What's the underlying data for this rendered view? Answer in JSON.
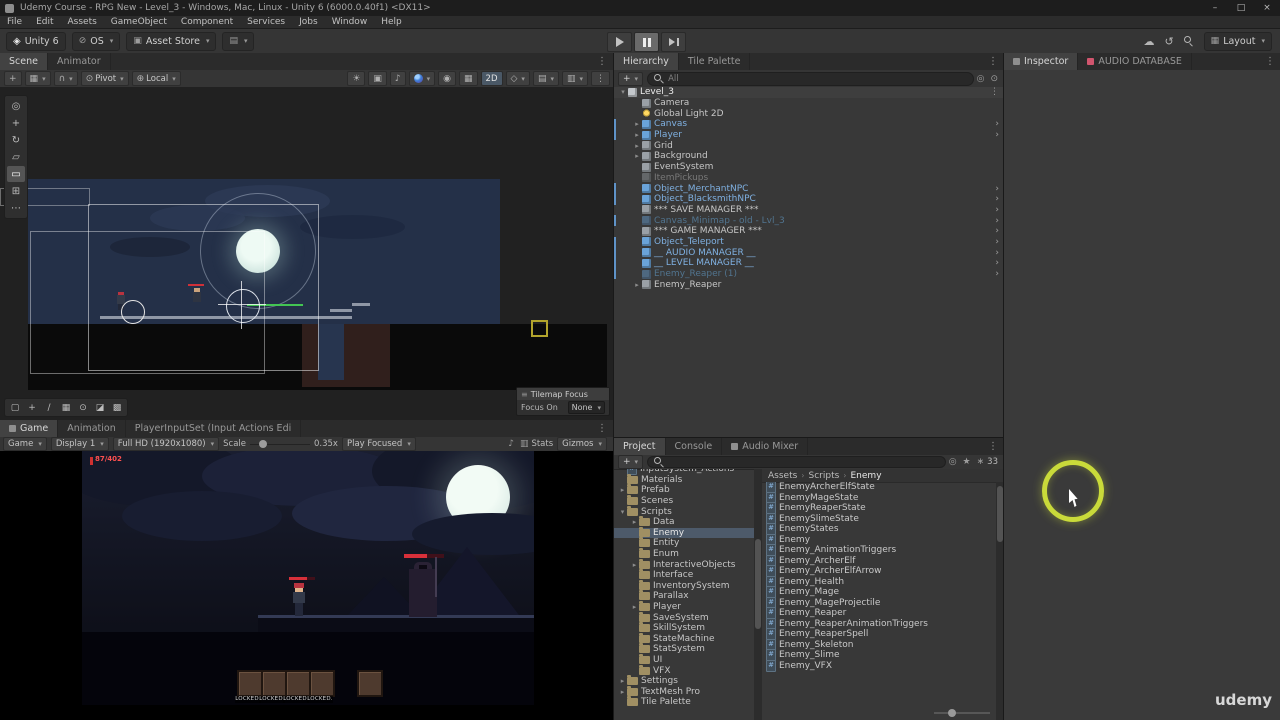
{
  "window": {
    "title": "Udemy Course - RPG New - Level_3 - Windows, Mac, Linux - Unity 6 (6000.0.40f1) <DX11>",
    "controls": {
      "minimize": "–",
      "maximize": "□",
      "close": "×"
    }
  },
  "menu_bar": [
    "File",
    "Edit",
    "Assets",
    "GameObject",
    "Component",
    "Services",
    "Jobs",
    "Window",
    "Help"
  ],
  "top_toolbar": {
    "unity_version": "Unity 6",
    "account_label": "OS",
    "asset_store_label": "Asset Store",
    "layout_label": "Layout",
    "play_controls": [
      "play",
      "pause",
      "step"
    ]
  },
  "scene_panel": {
    "tabs": [
      {
        "label": "Scene"
      },
      {
        "label": "Animator"
      }
    ],
    "toolbar_left": [
      {
        "name": "tool-settings-icon",
        "glyph": "+"
      },
      {
        "name": "grid-snapping-dropdown",
        "glyph": "▦",
        "arrow": true
      },
      {
        "name": "snap-toggle-dropdown",
        "glyph": "∩",
        "arrow": true
      },
      {
        "name": "pivot-mode-dropdown",
        "glyph": "⊙",
        "label": "Pivot",
        "arrow": true
      },
      {
        "name": "orientation-dropdown",
        "glyph": "⊕",
        "label": "Local",
        "arrow": true
      }
    ],
    "toolbar_right": [
      {
        "name": "lighting-toggle-icon",
        "glyph": "☀"
      },
      {
        "name": "camera-view-icon",
        "glyph": "▣"
      },
      {
        "name": "audio-toggle-icon",
        "glyph": "♪"
      },
      {
        "name": "effects-orb-icon",
        "orb": true,
        "arrow": true
      },
      {
        "name": "scene-visibility-icon",
        "glyph": "◉"
      },
      {
        "name": "grid-visibility-icon",
        "glyph": "▦"
      },
      {
        "name": "mode-2d-toggle",
        "label": "2D",
        "active": true
      },
      {
        "name": "gizmo-style-dropdown",
        "glyph": "◇",
        "arrow": true
      },
      {
        "name": "overlays-dropdown",
        "glyph": "▤",
        "arrow": true
      },
      {
        "name": "camera-settings-dropdown",
        "glyph": "▥",
        "arrow": true
      },
      {
        "name": "scene-more-icon",
        "glyph": "⋮"
      }
    ],
    "tools": [
      {
        "name": "view-tool",
        "glyph": "◎"
      },
      {
        "name": "move-tool",
        "glyph": "+"
      },
      {
        "name": "rotate-tool",
        "glyph": "↻"
      },
      {
        "name": "scale-tool",
        "glyph": "▱"
      },
      {
        "name": "rect-tool",
        "glyph": "▭",
        "active": true
      },
      {
        "name": "transform-tool",
        "glyph": "⊞"
      },
      {
        "name": "custom-tool",
        "glyph": "⋯"
      }
    ],
    "tile_tools": [
      {
        "name": "tile-select-tool",
        "glyph": "▢"
      },
      {
        "name": "tile-move-tool",
        "glyph": "+"
      },
      {
        "name": "tile-brush-tool",
        "glyph": "∕"
      },
      {
        "name": "tile-box-tool",
        "glyph": "▦"
      },
      {
        "name": "tile-picker-tool",
        "glyph": "⊙"
      },
      {
        "name": "tile-eraser-tool",
        "glyph": "◪"
      },
      {
        "name": "tile-fill-tool",
        "glyph": "▩"
      }
    ],
    "focus_overlay": {
      "title": "Tilemap Focus",
      "label": "Focus On",
      "value": "None"
    }
  },
  "game_panel": {
    "tabs": [
      {
        "label": "Game",
        "icon": "generic"
      },
      {
        "label": "Animation"
      },
      {
        "label": "PlayerInputSet (Input Actions Edi"
      }
    ],
    "toolbar": {
      "view_selector": "Game",
      "display": "Display 1",
      "resolution": "Full HD (1920x1080)",
      "scale_label": "Scale",
      "scale_value": "0.35x",
      "focus_mode": "Play Focused",
      "stats_label": "Stats",
      "gizmos_label": "Gizmos"
    },
    "hud_health": "87/402",
    "locked_slots": [
      "LOCKED.",
      "LOCKED.",
      "LOCKED.",
      "LOCKED."
    ]
  },
  "hierarchy_panel": {
    "tabs": [
      {
        "label": "Hierarchy"
      },
      {
        "label": "Tile Palette"
      }
    ],
    "search_placeholder": "All",
    "items": [
      {
        "label": "Level_3",
        "icon": "scene",
        "style": "root",
        "expander": "open",
        "menu": true
      },
      {
        "label": "Camera",
        "icon": "camera",
        "style": "normal"
      },
      {
        "label": "Global Light 2D",
        "icon": "light",
        "style": "normal"
      },
      {
        "label": "Canvas",
        "icon": "prefab",
        "style": "prefab",
        "expander": "closed",
        "nav": true,
        "bar": true
      },
      {
        "label": "Player",
        "icon": "prefab",
        "style": "prefab",
        "expander": "closed",
        "nav": true,
        "bar": true
      },
      {
        "label": "Grid",
        "icon": "grid",
        "style": "normal",
        "expander": "closed"
      },
      {
        "label": "Background",
        "icon": "go",
        "style": "normal",
        "expander": "closed"
      },
      {
        "label": "EventSystem",
        "icon": "go",
        "style": "normal"
      },
      {
        "label": "ItemPickups",
        "icon": "go",
        "style": "disabled"
      },
      {
        "label": "Object_MerchantNPC",
        "icon": "prefab",
        "style": "prefab",
        "nav": true,
        "bar": true
      },
      {
        "label": "Object_BlacksmithNPC",
        "icon": "prefab",
        "style": "prefab",
        "nav": true,
        "bar": true
      },
      {
        "label": "*** SAVE MANAGER ***",
        "icon": "go",
        "style": "normal",
        "nav": true
      },
      {
        "label": "Canvas_Minimap - old - Lvl_3",
        "icon": "prefab",
        "style": "disabled-prefab",
        "nav": true,
        "bar": true
      },
      {
        "label": "*** GAME MANAGER ***",
        "icon": "go",
        "style": "normal",
        "nav": true
      },
      {
        "label": "Object_Teleport",
        "icon": "prefab",
        "style": "prefab",
        "nav": true,
        "bar": true
      },
      {
        "label": "__ AUDIO MANAGER __",
        "icon": "prefab",
        "style": "prefab",
        "nav": true,
        "bar": true
      },
      {
        "label": "__ LEVEL MANAGER __",
        "icon": "prefab",
        "style": "prefab",
        "nav": true,
        "bar": true
      },
      {
        "label": "Enemy_Reaper (1)",
        "icon": "prefab",
        "style": "disabled-prefab",
        "nav": true,
        "bar": true
      },
      {
        "label": "Enemy_Reaper",
        "icon": "go",
        "style": "normal",
        "expander": "closed"
      }
    ]
  },
  "project_panel": {
    "tabs": [
      {
        "label": "Project"
      },
      {
        "label": "Console"
      },
      {
        "label": "Audio Mixer",
        "icon": "generic"
      }
    ],
    "search_placeholder": "",
    "hidden_count": "33",
    "breadcrumb": [
      "Assets",
      "Scripts",
      "Enemy"
    ],
    "folders": [
      {
        "label": "InputSystem_Actions",
        "indent": 0,
        "icon": "asset",
        "clipped": true
      },
      {
        "label": "Materials",
        "indent": 0
      },
      {
        "label": "Prefab",
        "indent": 0,
        "expander": "closed"
      },
      {
        "label": "Scenes",
        "indent": 0
      },
      {
        "label": "Scripts",
        "indent": 0,
        "expander": "open"
      },
      {
        "label": "Data",
        "indent": 1,
        "expander": "closed"
      },
      {
        "label": "Enemy",
        "indent": 1,
        "selected": true
      },
      {
        "label": "Entity",
        "indent": 1
      },
      {
        "label": "Enum",
        "indent": 1
      },
      {
        "label": "InteractiveObjects",
        "indent": 1,
        "expander": "closed"
      },
      {
        "label": "Interface",
        "indent": 1
      },
      {
        "label": "InventorySystem",
        "indent": 1
      },
      {
        "label": "Parallax",
        "indent": 1
      },
      {
        "label": "Player",
        "indent": 1,
        "expander": "closed"
      },
      {
        "label": "SaveSystem",
        "indent": 1
      },
      {
        "label": "SkillSystem",
        "indent": 1
      },
      {
        "label": "StateMachine",
        "indent": 1
      },
      {
        "label": "StatSystem",
        "indent": 1
      },
      {
        "label": "UI",
        "indent": 1
      },
      {
        "label": "VFX",
        "indent": 1
      },
      {
        "label": "Settings",
        "indent": 0,
        "expander": "closed"
      },
      {
        "label": "TextMesh Pro",
        "indent": 0,
        "expander": "closed"
      },
      {
        "label": "Tile Palette",
        "indent": 0
      }
    ],
    "files": [
      "EnemyArcherElfState",
      "EnemyMageState",
      "EnemyReaperState",
      "EnemySlimeState",
      "EnemyStates",
      "Enemy",
      "Enemy_AnimationTriggers",
      "Enemy_ArcherElf",
      "Enemy_ArcherElfArrow",
      "Enemy_Health",
      "Enemy_Mage",
      "Enemy_MageProjectile",
      "Enemy_Reaper",
      "Enemy_ReaperAnimationTriggers",
      "Enemy_ReaperSpell",
      "Enemy_Skeleton",
      "Enemy_Slime",
      "Enemy_VFX"
    ]
  },
  "inspector_panel": {
    "tabs": [
      {
        "label": "Inspector",
        "icon": "generic"
      },
      {
        "label": "AUDIO DATABASE",
        "icon": "audio-db"
      }
    ]
  },
  "watermark": "udemy",
  "colors": {
    "prefab_blue": "#7fb0e1",
    "accent_blue": "#5f93c8",
    "selection": "#4d5a6a",
    "folder": "#a08f63",
    "health_red": "#d8303a",
    "highlight_ring": "#c9da3a"
  }
}
